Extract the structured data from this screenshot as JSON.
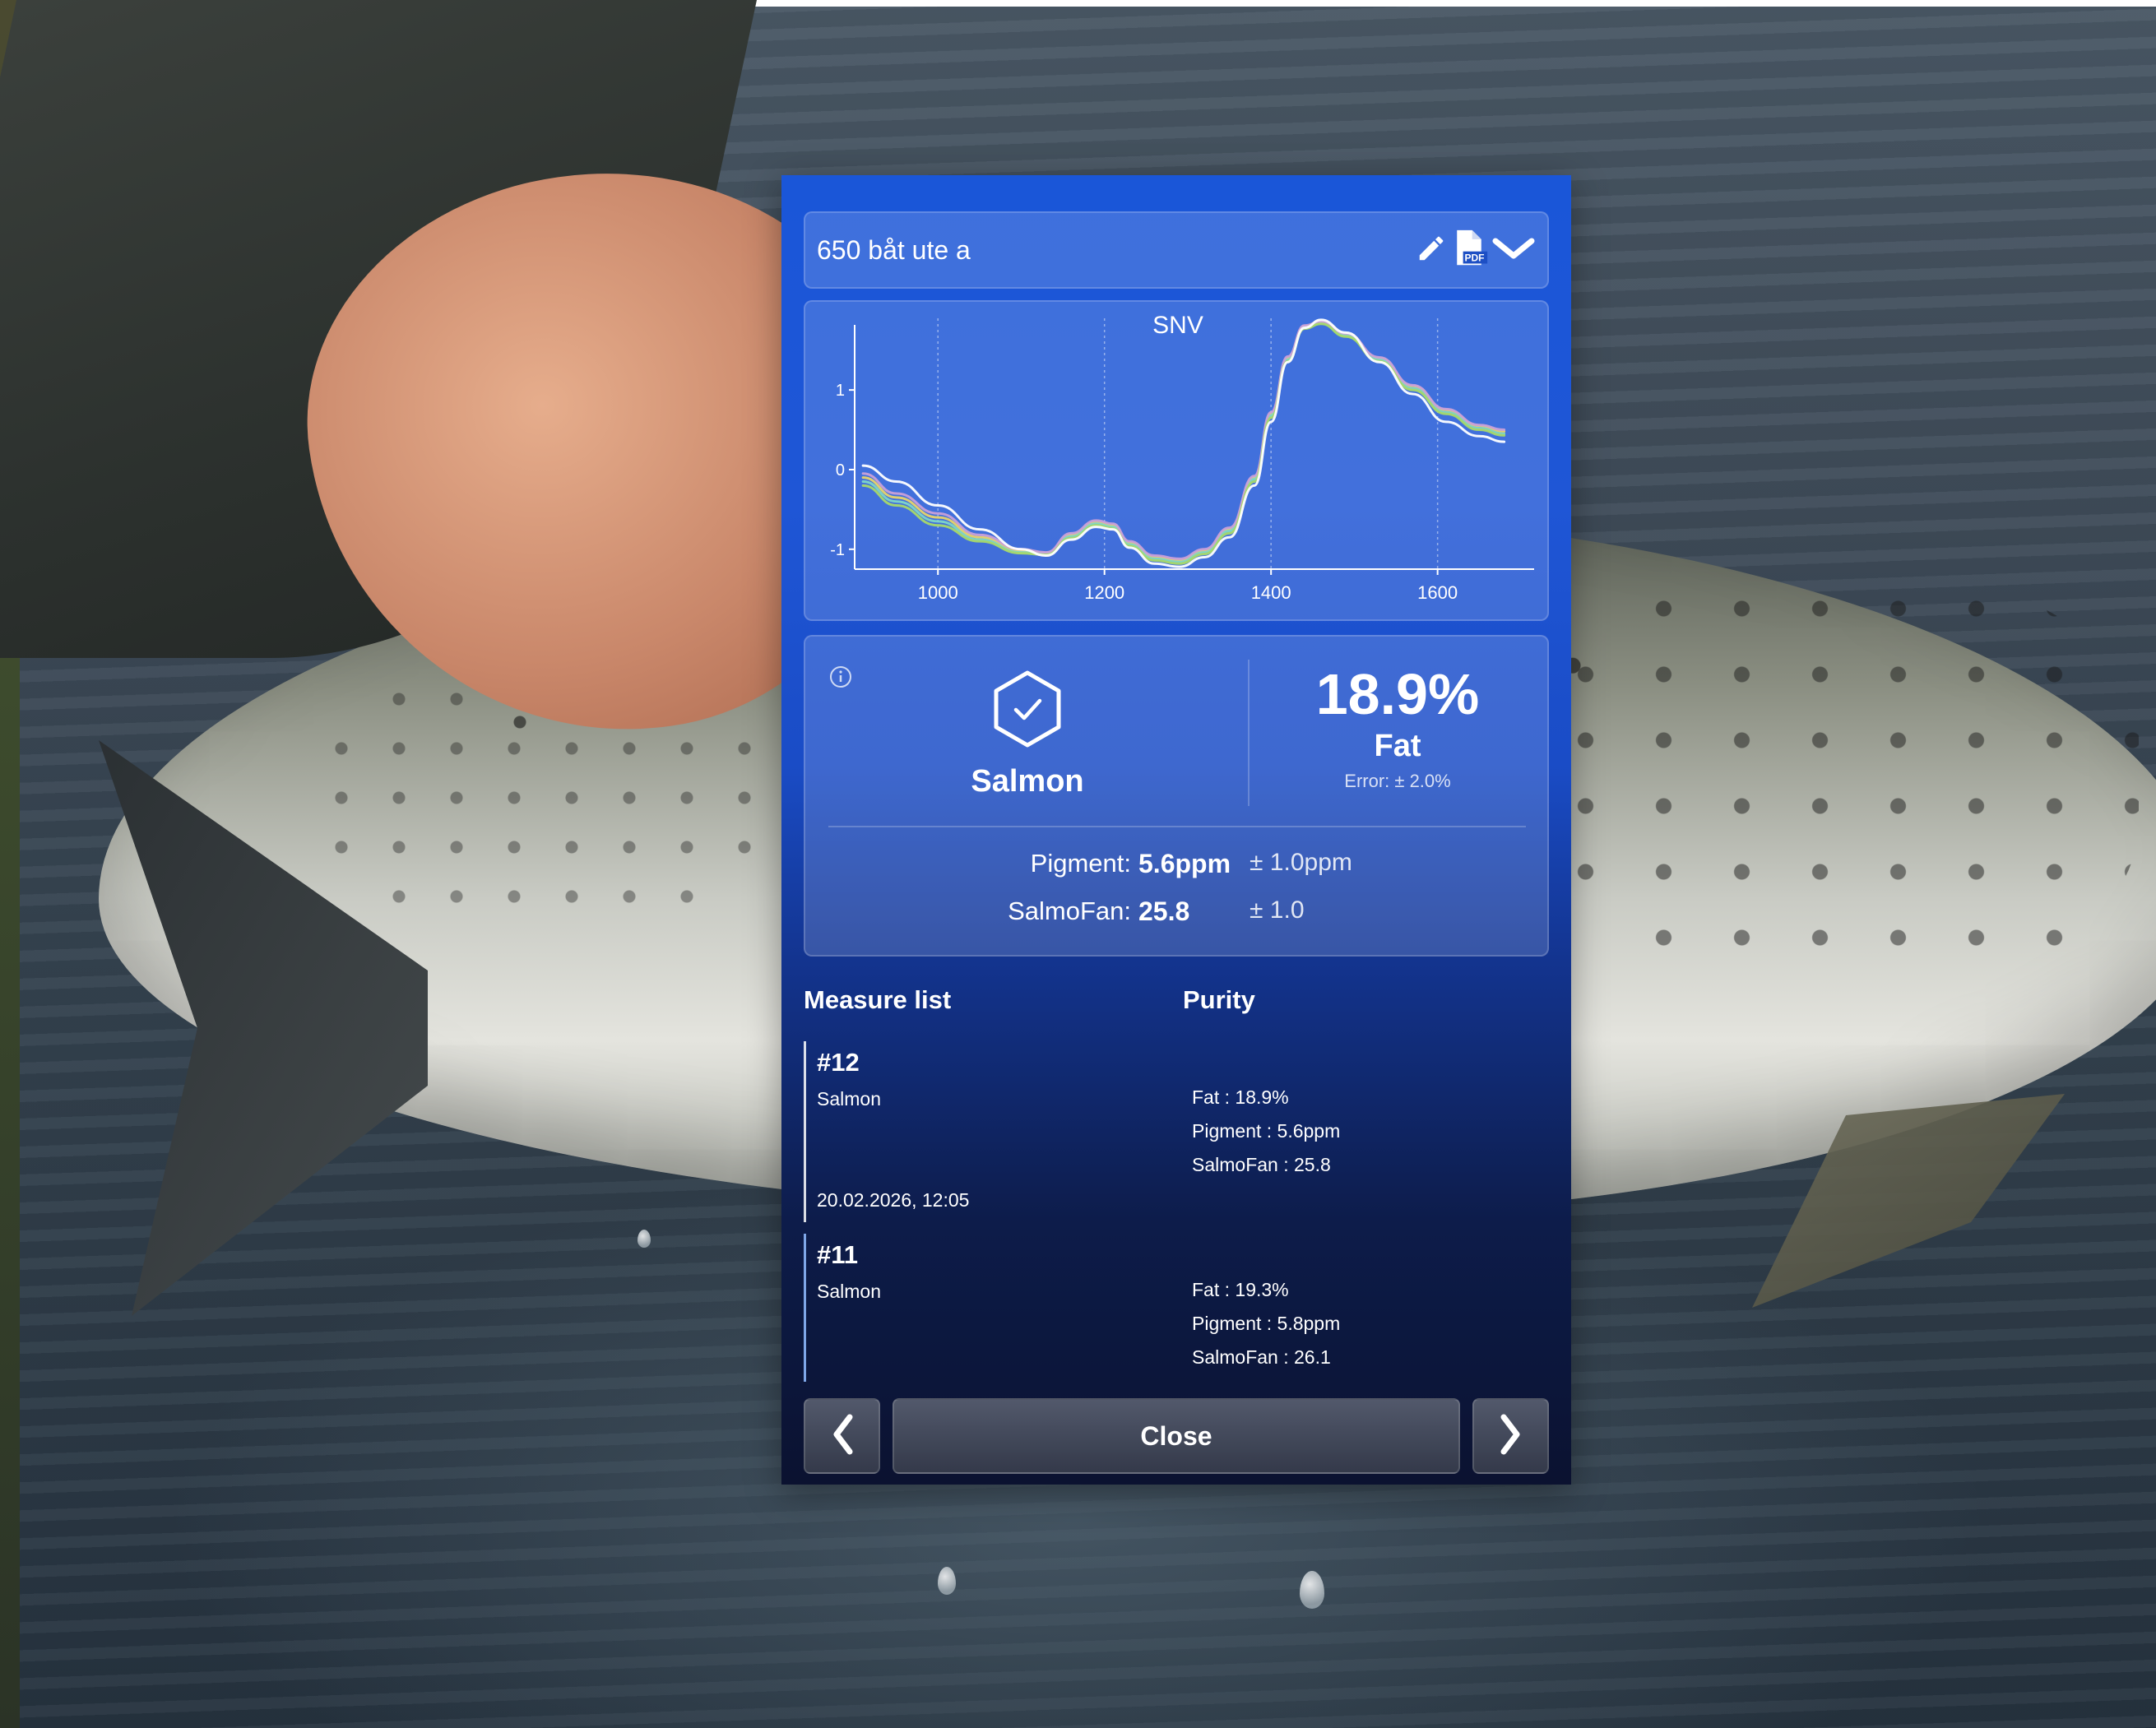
{
  "header": {
    "title": "650 båt ute a"
  },
  "icons": {
    "edit": "pencil-icon",
    "pdf": "pdf-file-icon",
    "expand": "chevron-down-icon",
    "info": "info-icon",
    "species": "hexagon-check-icon",
    "prev": "chevron-left-icon",
    "next": "chevron-right-icon"
  },
  "colors": {
    "accent": "#1a56d8",
    "panel_bottom": "#0b1230"
  },
  "chart_data": {
    "type": "line",
    "title": "SNV",
    "xlabel": "",
    "ylabel": "",
    "xlim": [
      900,
      1710
    ],
    "ylim": [
      -1.25,
      1.9
    ],
    "x_ticks": [
      1000,
      1200,
      1400,
      1600
    ],
    "y_ticks": [
      -1,
      0,
      1
    ],
    "grid": "vertical dashed",
    "series": [
      {
        "color": "#ffffff",
        "x": [
          910,
          950,
          1000,
          1050,
          1100,
          1130,
          1160,
          1190,
          1210,
          1230,
          1260,
          1290,
          1320,
          1350,
          1380,
          1400,
          1420,
          1440,
          1460,
          1490,
          1530,
          1570,
          1610,
          1650,
          1680
        ],
        "y": [
          0.05,
          -0.15,
          -0.45,
          -0.75,
          -1.0,
          -1.08,
          -0.88,
          -0.72,
          -0.75,
          -0.98,
          -1.18,
          -1.22,
          -1.1,
          -0.85,
          -0.2,
          0.6,
          1.35,
          1.78,
          1.88,
          1.72,
          1.35,
          0.95,
          0.6,
          0.42,
          0.35
        ]
      },
      {
        "color": "#e8d46a",
        "x": [
          910,
          950,
          1000,
          1050,
          1100,
          1130,
          1160,
          1190,
          1210,
          1230,
          1260,
          1290,
          1320,
          1350,
          1380,
          1400,
          1420,
          1440,
          1460,
          1490,
          1530,
          1570,
          1610,
          1650,
          1680
        ],
        "y": [
          -0.1,
          -0.35,
          -0.6,
          -0.85,
          -1.02,
          -1.05,
          -0.82,
          -0.66,
          -0.7,
          -0.92,
          -1.1,
          -1.14,
          -1.02,
          -0.75,
          -0.1,
          0.7,
          1.4,
          1.8,
          1.85,
          1.7,
          1.4,
          1.05,
          0.75,
          0.55,
          0.48
        ]
      },
      {
        "color": "#7ed6c8",
        "x": [
          910,
          950,
          1000,
          1050,
          1100,
          1130,
          1160,
          1190,
          1210,
          1230,
          1260,
          1290,
          1320,
          1350,
          1380,
          1400,
          1420,
          1440,
          1460,
          1490,
          1530,
          1570,
          1610,
          1650,
          1680
        ],
        "y": [
          -0.15,
          -0.4,
          -0.65,
          -0.88,
          -1.04,
          -1.06,
          -0.84,
          -0.68,
          -0.72,
          -0.94,
          -1.12,
          -1.16,
          -1.04,
          -0.77,
          -0.12,
          0.68,
          1.38,
          1.79,
          1.84,
          1.68,
          1.38,
          1.02,
          0.72,
          0.52,
          0.45
        ]
      },
      {
        "color": "#c9a0d8",
        "x": [
          910,
          950,
          1000,
          1050,
          1100,
          1130,
          1160,
          1190,
          1210,
          1230,
          1260,
          1290,
          1320,
          1350,
          1380,
          1400,
          1420,
          1440,
          1460,
          1490,
          1530,
          1570,
          1610,
          1650,
          1680
        ],
        "y": [
          -0.05,
          -0.3,
          -0.55,
          -0.82,
          -1.0,
          -1.04,
          -0.8,
          -0.64,
          -0.68,
          -0.9,
          -1.08,
          -1.12,
          -1.0,
          -0.73,
          -0.08,
          0.72,
          1.42,
          1.81,
          1.86,
          1.71,
          1.41,
          1.06,
          0.76,
          0.56,
          0.5
        ]
      },
      {
        "color": "#a8d86a",
        "x": [
          910,
          950,
          1000,
          1050,
          1100,
          1130,
          1160,
          1190,
          1210,
          1230,
          1260,
          1290,
          1320,
          1350,
          1380,
          1400,
          1420,
          1440,
          1460,
          1490,
          1530,
          1570,
          1610,
          1650,
          1680
        ],
        "y": [
          -0.2,
          -0.45,
          -0.7,
          -0.9,
          -1.05,
          -1.07,
          -0.86,
          -0.7,
          -0.74,
          -0.96,
          -1.14,
          -1.18,
          -1.06,
          -0.8,
          -0.15,
          0.65,
          1.36,
          1.77,
          1.83,
          1.67,
          1.36,
          1.0,
          0.7,
          0.5,
          0.43
        ]
      }
    ]
  },
  "result": {
    "species": "Salmon",
    "fat_value": "18.9%",
    "fat_label": "Fat",
    "fat_error": "Error: ± 2.0%",
    "pigment_label": "Pigment:",
    "pigment_value": "5.6ppm",
    "pigment_error": "± 1.0ppm",
    "salmofan_label": "SalmoFan:",
    "salmofan_value": "25.8",
    "salmofan_error": "± 1.0"
  },
  "measure_list": {
    "heading": "Measure list",
    "purity_heading": "Purity",
    "items": [
      {
        "number": "#12",
        "species": "Salmon",
        "datetime": "20.02.2026, 12:05",
        "fat": "Fat : 18.9%",
        "pigment": "Pigment : 5.6ppm",
        "salmofan": "SalmoFan : 25.8"
      },
      {
        "number": "#11",
        "species": "Salmon",
        "datetime": "",
        "fat": "Fat : 19.3%",
        "pigment": "Pigment : 5.8ppm",
        "salmofan": "SalmoFan : 26.1"
      }
    ]
  },
  "footer": {
    "close_label": "Close",
    "prev_glyph": "❮",
    "next_glyph": "❯"
  }
}
